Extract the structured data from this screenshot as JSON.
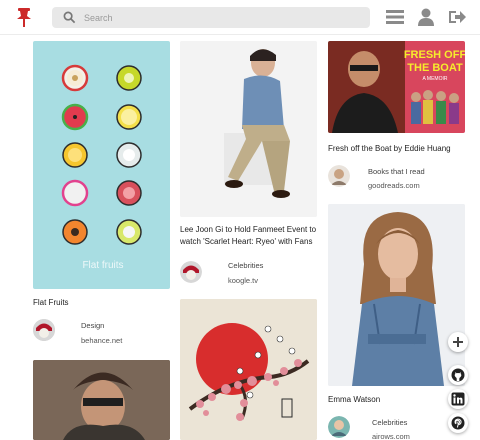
{
  "search": {
    "placeholder": "Search"
  },
  "brand_color": "#cc2a2a",
  "icons": {
    "logo": "pushpin-icon",
    "search": "search-icon",
    "menu": "hamburger-menu-icon",
    "profile": "user-icon",
    "logout": "logout-icon",
    "add": "plus-icon",
    "github": "github-icon",
    "linkedin": "linkedin-icon",
    "pinterest": "pinterest-icon"
  },
  "pins": [
    {
      "title": "Flat Fruits",
      "category": "Design",
      "source": "behance.net",
      "image_text": "Flat fruits"
    },
    {
      "title": "Lee Joon Gi to Hold Fanmeet Event to watch 'Scarlet Heart: Ryeo' with Fans",
      "category": "Celebrities",
      "source": "koogle.tv"
    },
    {
      "title": "Fresh off the Boat by Eddie Huang",
      "category": "Books that I read",
      "source": "goodreads.com",
      "image_text": {
        "line1": "FRESH OFF",
        "line2": "THE BOAT",
        "line3": "A MEMOIR"
      }
    },
    {
      "title": "Emma Watson",
      "category": "Celebrities",
      "source": "airows.com"
    },
    {
      "title": "",
      "category": "",
      "source": ""
    },
    {
      "title": "",
      "category": "",
      "source": ""
    }
  ],
  "fab": {
    "add_label": "+"
  }
}
